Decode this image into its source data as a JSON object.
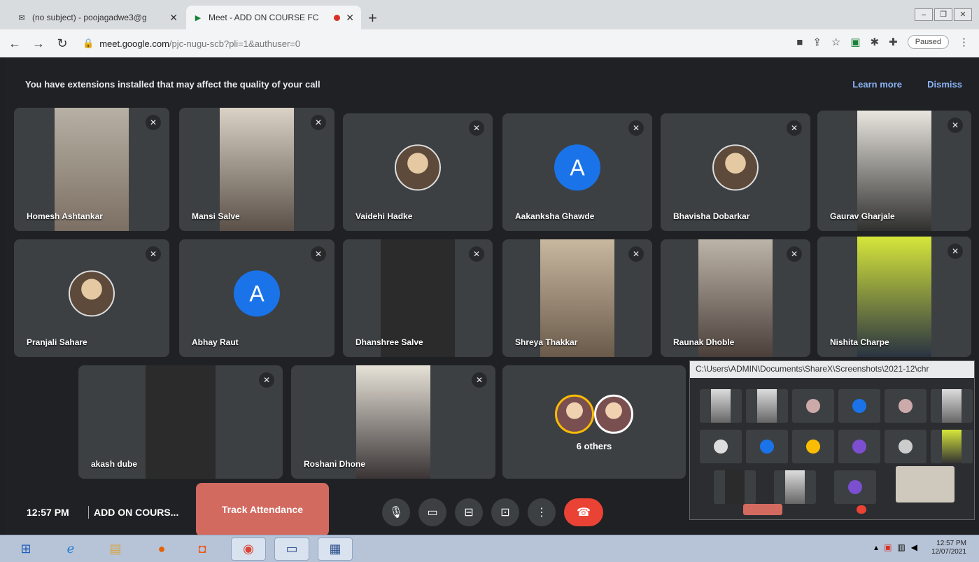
{
  "browser": {
    "tabs": [
      {
        "label": "(no subject) - poojagadwe3@g",
        "active": false
      },
      {
        "label": "Meet - ADD ON COURSE FC",
        "active": true
      }
    ],
    "url_host": "meet.google.com",
    "url_path": "/pjc-nugu-scb?pli=1&authuser=0",
    "profile_label": "Paused"
  },
  "banner": {
    "message": "You have extensions installed that may affect the quality of your call",
    "learn_more": "Learn more",
    "dismiss": "Dismiss"
  },
  "participants": [
    {
      "name": "Homesh Ashtankar",
      "kind": "video"
    },
    {
      "name": "Mansi Salve",
      "kind": "video"
    },
    {
      "name": "Vaidehi Hadke",
      "kind": "photo"
    },
    {
      "name": "Aakanksha Ghawde",
      "kind": "avatar",
      "initial": "A"
    },
    {
      "name": "Bhavisha Dobarkar",
      "kind": "photo"
    },
    {
      "name": "Gaurav Gharjale",
      "kind": "video"
    },
    {
      "name": "Pranjali Sahare",
      "kind": "photo"
    },
    {
      "name": "Abhay Raut",
      "kind": "avatar",
      "initial": "A"
    },
    {
      "name": "Dhanshree Salve",
      "kind": "dark"
    },
    {
      "name": "Shreya Thakkar",
      "kind": "video"
    },
    {
      "name": "Raunak Dhoble",
      "kind": "video"
    },
    {
      "name": "Nishita Charpe",
      "kind": "video"
    },
    {
      "name": "akash dube",
      "kind": "dark"
    },
    {
      "name": "Roshani Dhone",
      "kind": "video"
    }
  ],
  "others": {
    "label": "6 others"
  },
  "bottom_bar": {
    "time": "12:57 PM",
    "meeting_title": "ADD ON COURS...",
    "track_attendance": "Track Attendance"
  },
  "screenshare": {
    "title": "C:\\Users\\ADMIN\\Documents\\ShareX\\Screenshots\\2021-12\\chr"
  },
  "taskbar": {
    "time": "12:57 PM",
    "date": "12/07/2021"
  },
  "colors": {
    "meet_bg": "#202124",
    "tile_bg": "#3c4043",
    "accent_blue": "#1a73e8",
    "end_call_red": "#ea4335",
    "track_button": "#d36a60",
    "link_blue": "#8ab4f8"
  }
}
